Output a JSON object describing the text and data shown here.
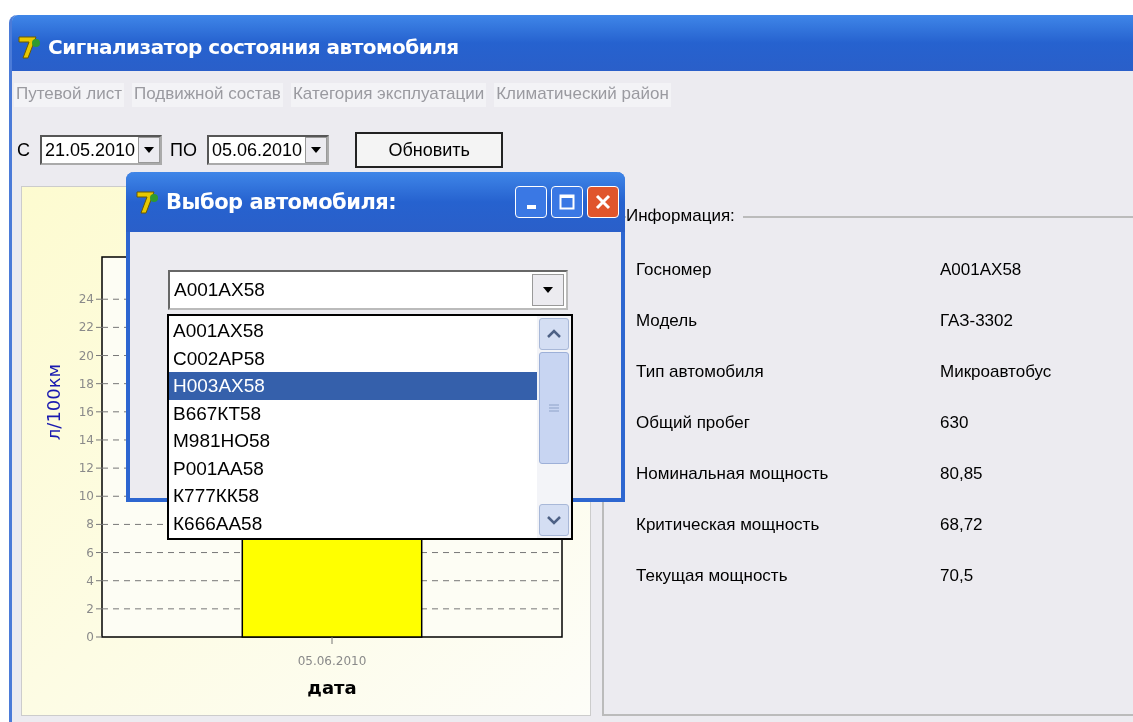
{
  "window": {
    "title": "Сигнализатор состояния автомобиля"
  },
  "menu": [
    {
      "label": "Путевой лист",
      "disabled": true
    },
    {
      "label": "Подвижной состав",
      "disabled": true
    },
    {
      "label": "Категория эксплуатации",
      "disabled": true
    },
    {
      "label": "Климатический район",
      "disabled": true
    }
  ],
  "filter": {
    "from_label": "С",
    "from_value": "21.05.2010",
    "to_label": "ПО",
    "to_value": "05.06.2010",
    "button": "Обновить"
  },
  "chart": {
    "xlabel": "дата",
    "ylabel": "л/100км",
    "x_ticks": [
      "05.06.2010"
    ],
    "y_ticks": [
      "24",
      "22",
      "20",
      "18",
      "16",
      "14",
      "12",
      "10",
      "8",
      "6",
      "4",
      "2",
      "0"
    ]
  },
  "info": {
    "title": "Информация:",
    "rows": [
      {
        "label": "Госномер",
        "value": "А001АХ58"
      },
      {
        "label": "Модель",
        "value": "ГАЗ-3302"
      },
      {
        "label": "Тип автомобиля",
        "value": "Микроавтобус"
      },
      {
        "label": "Общий пробег",
        "value": "630"
      },
      {
        "label": "Номинальная мощность",
        "value": "80,85"
      },
      {
        "label": "Критическая мощность",
        "value": "68,72"
      },
      {
        "label": "Текущая мощность",
        "value": "70,5"
      }
    ]
  },
  "dialog": {
    "title": "Выбор автомобиля:",
    "combo_value": "А001АХ58",
    "options": [
      {
        "label": "А001АХ58",
        "selected": false
      },
      {
        "label": "С002АР58",
        "selected": false
      },
      {
        "label": "Н003АХ58",
        "selected": true
      },
      {
        "label": "В667КТ58",
        "selected": false
      },
      {
        "label": "М981НО58",
        "selected": false
      },
      {
        "label": "Р001АА58",
        "selected": false
      },
      {
        "label": "К777КК58",
        "selected": false
      },
      {
        "label": "К666АА58",
        "selected": false
      }
    ]
  }
}
